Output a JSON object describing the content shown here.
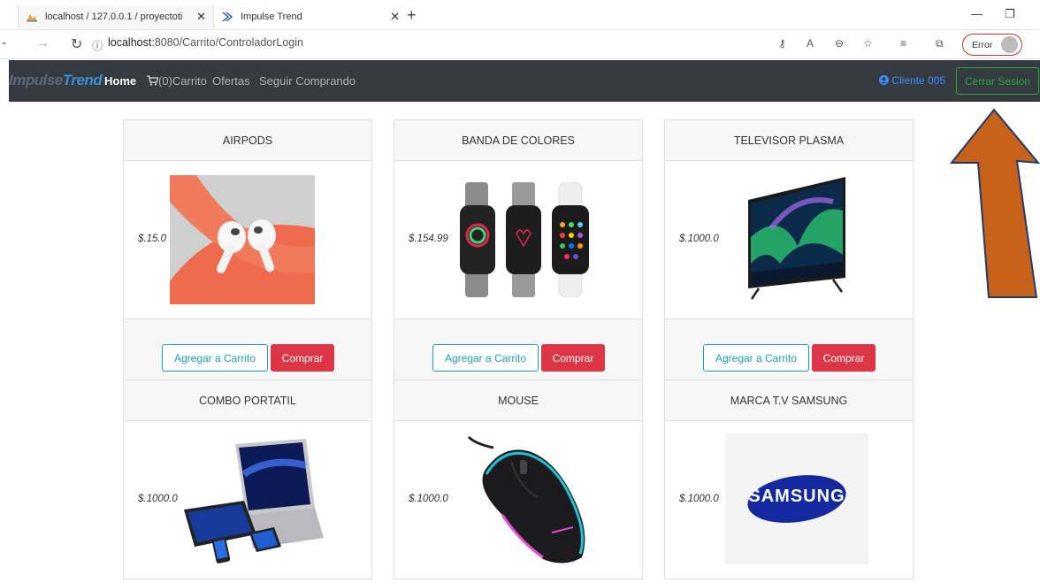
{
  "browser": {
    "tabs": [
      {
        "label": "localhost / 127.0.0.1 / proyectoti",
        "icon": "phpmyadmin-icon"
      },
      {
        "label": "Impulse Trend",
        "icon": "impulse-favicon"
      }
    ],
    "address": {
      "host": "localhost",
      "path": ":8080/Carrito/ControladorLogin"
    },
    "profile_label": "Error"
  },
  "navbar": {
    "brand_part1": "Impulse",
    "brand_part2": "Trend",
    "links": {
      "home": "Home",
      "cart": "(0)Carrito",
      "offers": "Ofertas",
      "keep_shopping": "Seguir Comprando"
    },
    "client": "Cliente 005",
    "logout": "Cerrar Sesion"
  },
  "products": [
    {
      "name": "AIRPODS",
      "price": "$.15.0"
    },
    {
      "name": "BANDA DE COLORES",
      "price": "$.154.99"
    },
    {
      "name": "TELEVISOR PLASMA",
      "price": "$.1000.0"
    },
    {
      "name": "COMBO PORTATIL",
      "price": "$.1000.0"
    },
    {
      "name": "MOUSE",
      "price": "$.1000.0"
    },
    {
      "name": "MARCA T.V SAMSUNG",
      "price": "$.1000.0",
      "logo_text": "SAMSUNG"
    }
  ],
  "buttons": {
    "add": "Agregar a Carrito",
    "buy": "Comprar"
  },
  "colors": {
    "navbar_bg": "#343a40",
    "add_button": "#17a2b8",
    "buy_button": "#dc3545",
    "logout_button": "#28a745",
    "client_link": "#3c8cff",
    "annotation_arrow": "#c8621a"
  }
}
